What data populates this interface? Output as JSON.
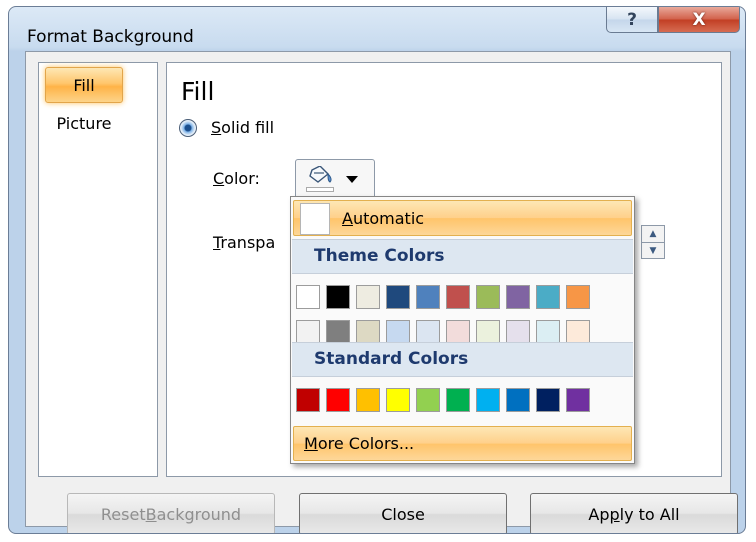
{
  "window": {
    "title": "Format Background",
    "help_glyph": "?",
    "close_glyph": "X"
  },
  "nav": {
    "items": [
      {
        "label": "Fill",
        "selected": true
      },
      {
        "label": "Picture",
        "selected": false
      }
    ]
  },
  "fill_panel": {
    "heading": "Fill",
    "solid_fill": {
      "pre": "",
      "access": "S",
      "post": "olid fill",
      "selected": true
    },
    "color": {
      "access": "C",
      "post": "olor:"
    },
    "transparency": {
      "access": "T",
      "post": "ranspa"
    }
  },
  "color_dropdown": {
    "automatic": {
      "access": "A",
      "post": "utomatic"
    },
    "theme_header": "Theme Colors",
    "theme_row_1": [
      "#ffffff",
      "#000000",
      "#eeece1",
      "#1f497d",
      "#4f81bd",
      "#c0504d",
      "#9bbb59",
      "#8064a2",
      "#4bacc6",
      "#f79646"
    ],
    "theme_row_2": [
      "#f2f2f2",
      "#7f7f7f",
      "#ddd9c3",
      "#c6d9f0",
      "#dbe5f1",
      "#f2dcdb",
      "#ebf1dd",
      "#e5e0ec",
      "#dbeef3",
      "#fdeada"
    ],
    "standard_header": "Standard Colors",
    "standard_row": [
      "#c00000",
      "#ff0000",
      "#ffc000",
      "#ffff00",
      "#92d050",
      "#00b050",
      "#00b0f0",
      "#0070c0",
      "#002060",
      "#7030a0"
    ],
    "more_colors": {
      "access": "M",
      "post": "ore Colors..."
    }
  },
  "buttons": {
    "reset": {
      "pre": "Reset ",
      "access": "B",
      "post": "ackground",
      "enabled": false
    },
    "close": "Close",
    "apply": {
      "pre": "Ap",
      "access": "p",
      "post": "ly to All"
    }
  },
  "colors": {
    "highlight": "#ffc46a",
    "section_header": "#1e3a6e"
  }
}
